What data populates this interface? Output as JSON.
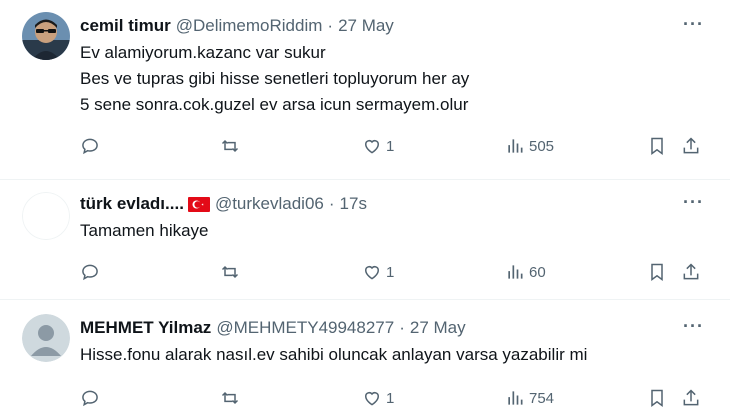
{
  "tweets": [
    {
      "name": "cemil timur",
      "handle": "@DelimemoRiddim",
      "separator": "·",
      "time": "27 May",
      "lines": [
        "Ev alamiyorum.kazanc var sukur",
        "Bes ve tupras gibi hisse senetleri topluyorum her ay",
        "5 sene sonra.cok.guzel ev arsa icun sermayem.olur"
      ],
      "likes": "1",
      "views": "505",
      "avatar": "person-photo"
    },
    {
      "name": "türk evladı....",
      "handle": "@turkevladi06",
      "separator": "·",
      "time": "17s",
      "lines": [
        "Tamamen hikaye"
      ],
      "likes": "1",
      "views": "60",
      "avatar": "blank"
    },
    {
      "name": "MEHMET Yilmaz",
      "handle": "@MEHMETY49948277",
      "separator": "·",
      "time": "27 May",
      "lines": [
        "Hisse.fonu alarak nasıl.ev sahibi oluncak anlayan varsa yazabilir mi"
      ],
      "likes": "1",
      "views": "754",
      "avatar": "default-person"
    }
  ],
  "more_label": "···",
  "colors": {
    "text": "#0f1419",
    "muted": "#536471",
    "divider": "#eff3f4",
    "flag_red": "#e30a17"
  }
}
